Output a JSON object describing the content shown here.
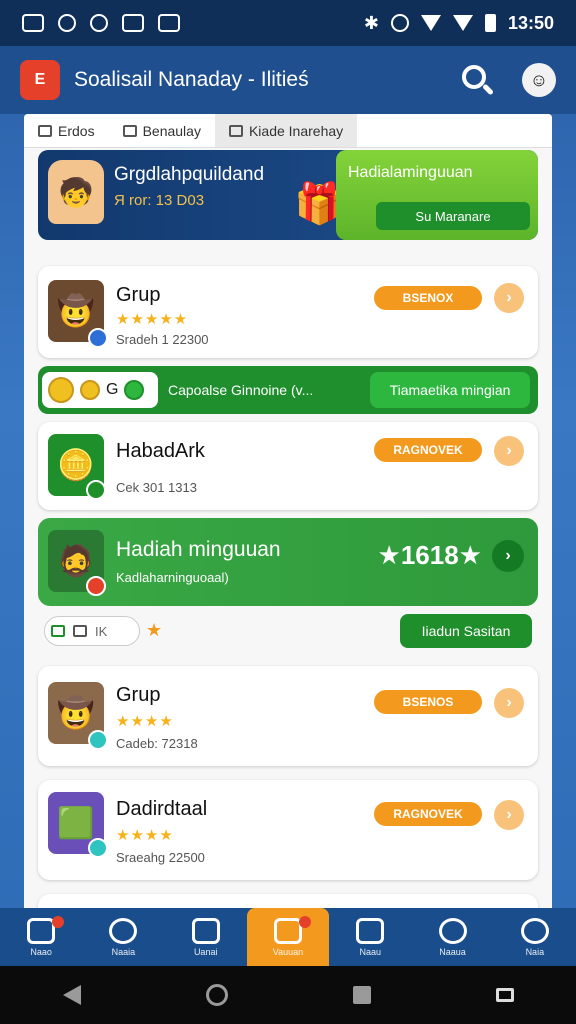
{
  "status_bar": {
    "time": "13:50"
  },
  "header": {
    "logo_text": "E",
    "title": "Soalisail Nanaday - Ilitieś",
    "search_icon": "search-icon",
    "avatar_icon": "avatar-icon"
  },
  "tabs": [
    {
      "label": "Erdos",
      "icon": "grid-icon"
    },
    {
      "label": "Benaulay",
      "icon": "calendar-icon"
    },
    {
      "label": "Kiade Inarehay",
      "icon": "camera-icon"
    }
  ],
  "promo": {
    "title": "Grgdlahpquildand",
    "subtitle": "Я ror: 13 D03",
    "right_title": "Hadialaminguuan",
    "button_label": "Su Maranare"
  },
  "cards": [
    {
      "title": "Grup",
      "stars": "★★★★★",
      "meta": "Sradeh 1 22300",
      "pill": "BSENOX"
    },
    {
      "title": "HabadArk",
      "stars": "",
      "meta": "Cek 301 1313",
      "pill": "RAGNOVEK"
    },
    {
      "title": "Grup",
      "stars": "★★★★",
      "meta": "Cadeb: 72318",
      "pill": "BSENOS"
    },
    {
      "title": "Dadirdtaal",
      "stars": "★★★★",
      "meta": "Sraeahg 22500",
      "pill": "RAGNOVEK"
    }
  ],
  "strip": {
    "coin_label": "G",
    "text": "Capoalse Ginnoine (v...",
    "button": "Tiamaetika mingian"
  },
  "green_card": {
    "title": "Hadiah minguuan",
    "subtitle": "Kadlaharninguoaal)",
    "score": "★1618★"
  },
  "mini_row": {
    "label": "IK",
    "button": "Iiadun Sasitan"
  },
  "bottom_nav": [
    {
      "label": "Naao",
      "icon": "home-icon"
    },
    {
      "label": "Naaia",
      "icon": "people-icon"
    },
    {
      "label": "Uanai",
      "icon": "mail-icon"
    },
    {
      "label": "Vauuan",
      "icon": "trophy-icon"
    },
    {
      "label": "Naau",
      "icon": "chat-icon"
    },
    {
      "label": "Naaua",
      "icon": "shield-icon"
    },
    {
      "label": "Naia",
      "icon": "info-icon"
    }
  ]
}
